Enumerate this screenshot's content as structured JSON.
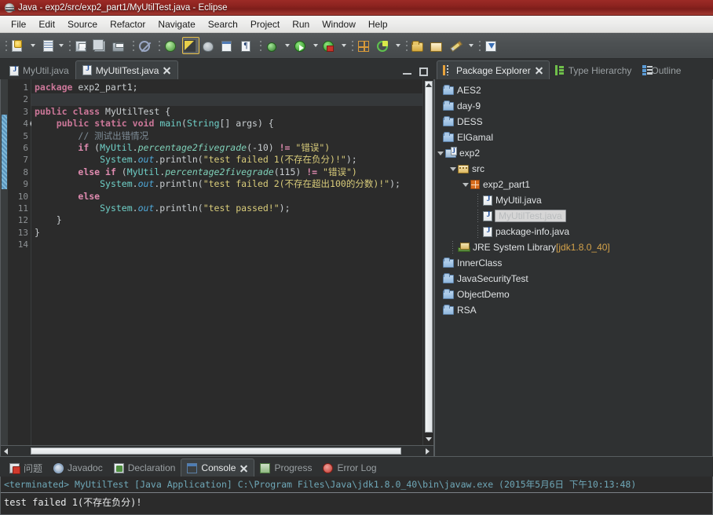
{
  "window": {
    "title": "Java - exp2/src/exp2_part1/MyUtilTest.java - Eclipse",
    "app_icon": "eclipse-icon"
  },
  "menubar": {
    "items": [
      {
        "label": "File"
      },
      {
        "label": "Edit"
      },
      {
        "label": "Source"
      },
      {
        "label": "Refactor"
      },
      {
        "label": "Navigate"
      },
      {
        "label": "Search"
      },
      {
        "label": "Project"
      },
      {
        "label": "Run"
      },
      {
        "label": "Window"
      },
      {
        "label": "Help"
      }
    ]
  },
  "toolbar": {
    "buttons": [
      {
        "name": "new-wizard-icon"
      },
      {
        "name": "new-java-class-icon"
      },
      {
        "name": "save-icon"
      },
      {
        "name": "save-all-icon"
      },
      {
        "name": "print-icon"
      },
      {
        "name": "no-access-icon"
      },
      {
        "name": "new-java-project-icon"
      },
      {
        "name": "java-perspective-icon"
      },
      {
        "name": "debug-icon"
      },
      {
        "name": "open-type-icon"
      },
      {
        "name": "open-task-icon"
      },
      {
        "name": "skip-breakpoints-icon"
      },
      {
        "name": "run-icon"
      },
      {
        "name": "run-external-tools-icon"
      },
      {
        "name": "new-package-icon"
      },
      {
        "name": "new-class-icon"
      },
      {
        "name": "open-folder-icon"
      },
      {
        "name": "open-resource-icon"
      },
      {
        "name": "edit-icon"
      },
      {
        "name": "import-icon"
      }
    ]
  },
  "editor": {
    "tabs": [
      {
        "label": "MyUtil.java",
        "active": false,
        "closable": false
      },
      {
        "label": "MyUtilTest.java",
        "active": true,
        "closable": true
      }
    ],
    "minimize_label": "Minimize",
    "maximize_label": "Maximize",
    "lines": [
      {
        "num": "1",
        "fold": false
      },
      {
        "num": "2",
        "fold": false
      },
      {
        "num": "3",
        "fold": false
      },
      {
        "num": "4",
        "fold": true
      },
      {
        "num": "5",
        "fold": false
      },
      {
        "num": "6",
        "fold": false
      },
      {
        "num": "7",
        "fold": false
      },
      {
        "num": "8",
        "fold": false
      },
      {
        "num": "9",
        "fold": false
      },
      {
        "num": "10",
        "fold": false
      },
      {
        "num": "11",
        "fold": false
      },
      {
        "num": "12",
        "fold": false
      },
      {
        "num": "13",
        "fold": false
      },
      {
        "num": "14",
        "fold": false
      }
    ],
    "code": {
      "l1_package_kw": "package",
      "l1_pkg_name": " exp2_part1;",
      "l3_public": "public",
      "l3_class": "class",
      "l3_name": " MyUtilTest ",
      "l3_brace": "{",
      "l4_public": "public",
      "l4_static": "static",
      "l4_void": "void",
      "l4_main": "main",
      "l4_paren": "(",
      "l4_String": "String",
      "l4_args": "[] args) {",
      "l5_comment": "// 测试出错情况",
      "l6_if": "if",
      "l6_open": " (",
      "l6_MyUtil": "MyUtil",
      "l6_dot": ".",
      "l6_method": "percentage2fivegrade",
      "l6_args": "(-10) ",
      "l6_op": "!=",
      "l6_str": " \"错误\")",
      "l7_System": "System",
      "l7_dot1": ".",
      "l7_out": "out",
      "l7_dot2": ".",
      "l7_println": "println",
      "l7_paren": "(",
      "l7_str": "\"test failed 1(不存在负分)!\"",
      "l7_end": ");",
      "l8_else": "else",
      "l8_if": " if",
      "l8_open": " (",
      "l8_MyUtil": "MyUtil",
      "l8_dot": ".",
      "l8_method": "percentage2fivegrade",
      "l8_args": "(115) ",
      "l8_op": "!=",
      "l8_str": " \"错误\")",
      "l9_System": "System",
      "l9_dot1": ".",
      "l9_out": "out",
      "l9_dot2": ".",
      "l9_println": "println",
      "l9_paren": "(",
      "l9_str": "\"test failed 2(不存在超出100的分数)!\"",
      "l9_end": ");",
      "l10_else": "else",
      "l11_System": "System",
      "l11_dot1": ".",
      "l11_out": "out",
      "l11_dot2": ".",
      "l11_println": "println",
      "l11_paren": "(",
      "l11_str": "\"test passed!\"",
      "l11_end": ");",
      "l12_brace": "}",
      "l13_brace": "}"
    }
  },
  "package_explorer": {
    "tabs": [
      {
        "label": "Package Explorer",
        "active": true,
        "closable": true,
        "icon": "package-explorer-icon"
      },
      {
        "label": "Type Hierarchy",
        "active": false,
        "closable": false,
        "icon": "type-hierarchy-icon"
      },
      {
        "label": "Outline",
        "active": false,
        "closable": false,
        "icon": "outline-icon"
      }
    ],
    "tree": [
      {
        "label": "AES2",
        "icon": "folder-icon",
        "indent": 1,
        "twisty": "none",
        "selected": false
      },
      {
        "label": "day-9",
        "icon": "folder-icon",
        "indent": 1,
        "twisty": "none",
        "selected": false
      },
      {
        "label": "DESS",
        "icon": "folder-icon",
        "indent": 1,
        "twisty": "none",
        "selected": false
      },
      {
        "label": "ElGamal",
        "icon": "folder-icon",
        "indent": 1,
        "twisty": "none",
        "selected": false
      },
      {
        "label": "exp2",
        "icon": "java-project-icon",
        "indent": 0,
        "twisty": "open",
        "selected": false
      },
      {
        "label": "src",
        "icon": "source-folder-icon",
        "indent": 1,
        "twisty": "open",
        "selected": false
      },
      {
        "label": "exp2_part1",
        "icon": "package-icon",
        "indent": 2,
        "twisty": "open",
        "selected": false
      },
      {
        "label": "MyUtil.java",
        "icon": "java-file-icon",
        "indent": 3,
        "twisty": "dots",
        "selected": false
      },
      {
        "label": "MyUtilTest.java",
        "icon": "java-file-icon",
        "indent": 3,
        "twisty": "dots",
        "selected": true
      },
      {
        "label": "package-info.java",
        "icon": "java-file-icon",
        "indent": 3,
        "twisty": "dots",
        "selected": false
      },
      {
        "label": "JRE System Library",
        "icon": "jre-library-icon",
        "indent": 2,
        "twisty": "dots",
        "selected": false,
        "suffix": " [jdk1.8.0_40]"
      },
      {
        "label": "InnerClass",
        "icon": "folder-icon",
        "indent": 1,
        "twisty": "none",
        "selected": false
      },
      {
        "label": "JavaSecurityTest",
        "icon": "folder-icon",
        "indent": 1,
        "twisty": "none",
        "selected": false
      },
      {
        "label": "ObjectDemo",
        "icon": "folder-icon",
        "indent": 1,
        "twisty": "none",
        "selected": false
      },
      {
        "label": "RSA",
        "icon": "folder-icon",
        "indent": 1,
        "twisty": "none",
        "selected": false
      }
    ]
  },
  "bottom_panel": {
    "tabs": [
      {
        "label": "问题",
        "active": false,
        "closable": false,
        "icon": "problems-icon"
      },
      {
        "label": "Javadoc",
        "active": false,
        "closable": false,
        "icon": "javadoc-icon"
      },
      {
        "label": "Declaration",
        "active": false,
        "closable": false,
        "icon": "declaration-icon"
      },
      {
        "label": "Console",
        "active": true,
        "closable": true,
        "icon": "console-icon"
      },
      {
        "label": "Progress",
        "active": false,
        "closable": false,
        "icon": "progress-icon"
      },
      {
        "label": "Error Log",
        "active": false,
        "closable": false,
        "icon": "error-log-icon"
      }
    ],
    "console": {
      "header": "<terminated> MyUtilTest [Java Application] C:\\Program Files\\Java\\jdk1.8.0_40\\bin\\javaw.exe (2015年5月6日 下午10:13:48)",
      "output": "test failed 1(不存在负分)!"
    }
  },
  "colors": {
    "title_bar": "#8e2420",
    "toolbar_bg": "#4c5052",
    "editor_bg": "#2b2b2b",
    "panel_bg": "#2f3132",
    "keyword": "#cc7799",
    "string": "#d9cc7a",
    "comment": "#7d8b96",
    "selection": "#d6d6d6"
  }
}
